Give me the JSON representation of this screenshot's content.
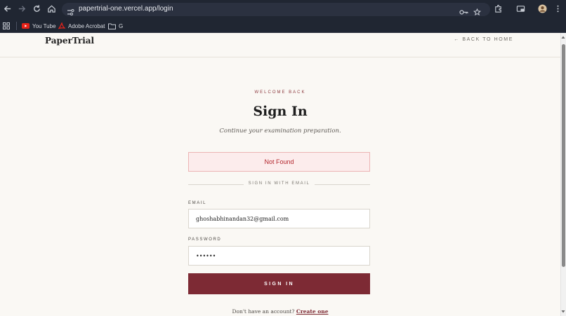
{
  "browser": {
    "url": "papertrial-one.vercel.app/login",
    "bookmarks": [
      {
        "label": "You Tube",
        "icon": "youtube-icon"
      },
      {
        "label": "Adobe Acrobat",
        "icon": "acrobat-icon"
      },
      {
        "label": "G",
        "icon": "folder-icon"
      }
    ]
  },
  "header": {
    "logo": "PaperTrial",
    "back_link": "← BACK TO HOME"
  },
  "login": {
    "eyebrow": "WELCOME BACK",
    "title": "Sign In",
    "subtitle": "Continue your examination preparation.",
    "error": "Not Found",
    "divider": "SIGN IN WITH EMAIL",
    "email_label": "EMAIL",
    "email_value": "ghoshabhinandan32@gmail.com",
    "password_label": "PASSWORD",
    "password_value": "••••••",
    "submit_label": "SIGN IN",
    "signup_prompt": "Don't have an account?",
    "signup_link": "Create one"
  },
  "colors": {
    "accent": "#7d2a34",
    "error_bg": "#fcecec",
    "error_text": "#b3262d",
    "page_bg": "#faf8f4"
  }
}
